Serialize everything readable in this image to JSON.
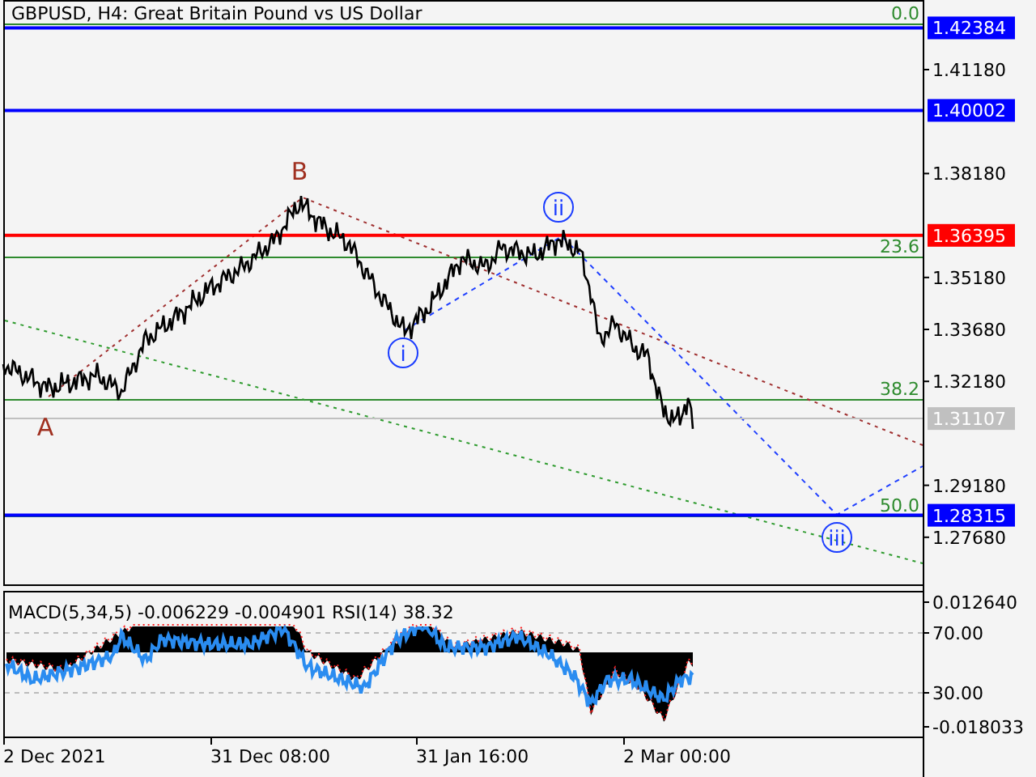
{
  "chart": {
    "title": "GBPUSD, H4:  Great Britain Pound vs US Dollar"
  },
  "price_axis": {
    "ticks": [
      "1.41180",
      "1.38180",
      "1.35180",
      "1.33680",
      "1.32180",
      "1.29180",
      "1.27680"
    ]
  },
  "price_levels": [
    {
      "label": "1.42384",
      "color": "#0000ff"
    },
    {
      "label": "1.40002",
      "color": "#0000ff"
    },
    {
      "label": "1.36395",
      "color": "#ff0000"
    },
    {
      "label": "1.31107",
      "color": "#c0c0c0"
    },
    {
      "label": "1.28315",
      "color": "#0000ff"
    }
  ],
  "fibonacci_levels": [
    "0.0",
    "23.6",
    "38.2",
    "50.0"
  ],
  "wave_labels": [
    {
      "text": "A",
      "kind": "plain"
    },
    {
      "text": "B",
      "kind": "plain"
    },
    {
      "text": "i",
      "kind": "circled"
    },
    {
      "text": "ii",
      "kind": "circled"
    },
    {
      "text": "iii",
      "kind": "circled"
    }
  ],
  "indicator": {
    "title": "MACD(5,34,5) -0.006229 -0.004901 RSI(14) 38.32",
    "axis_labels": [
      "0.012640",
      "70.00",
      "30.00",
      "-0.018033"
    ]
  },
  "time_axis": {
    "labels": [
      "2 Dec 2021",
      "31 Dec 08:00",
      "31 Jan 16:00",
      "2 Mar 00:00"
    ]
  }
}
